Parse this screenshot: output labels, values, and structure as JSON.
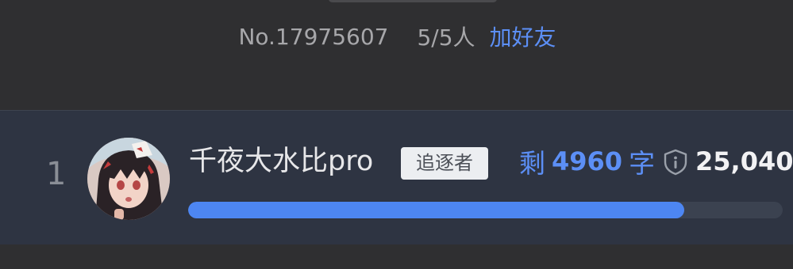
{
  "room": {
    "id_label": "No.17975607",
    "member_count": "5/5人",
    "add_friend_label": "加好友"
  },
  "leaderboard": {
    "rows": [
      {
        "rank": "1",
        "username": "千夜大水比pro",
        "role_badge": "追逐者",
        "remaining_prefix": "剩",
        "remaining_value": "4960",
        "remaining_suffix": "字",
        "score": "25,040",
        "progress_fraction": 0.835
      }
    ]
  },
  "icons": {
    "info": "shield-info-icon",
    "avatar": "anime-avatar"
  },
  "colors": {
    "accent": "#5c8ff6",
    "progress_fill": "#4d86f2",
    "row_background": "#2e3442",
    "page_background": "#2f2f31"
  }
}
